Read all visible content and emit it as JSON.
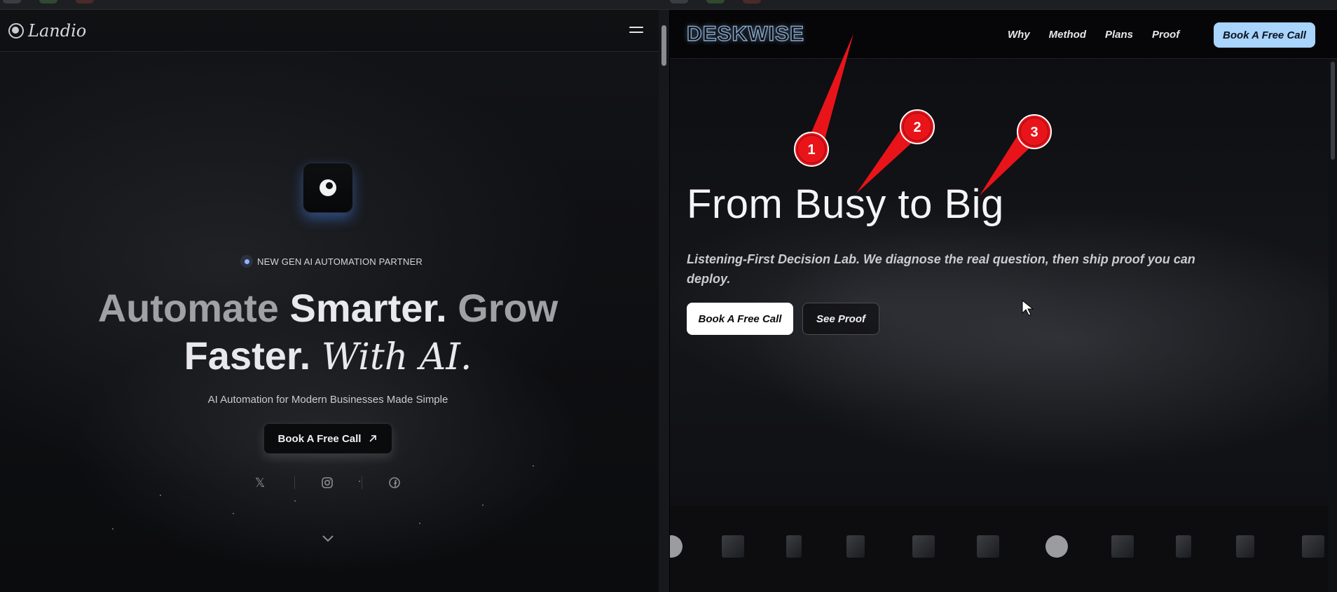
{
  "left_page": {
    "brand": "Landio",
    "badge": "NEW GEN AI AUTOMATION PARTNER",
    "headline": {
      "part1": "Automate ",
      "part2": "Smarter. ",
      "part3": "Grow",
      "part4": "Faster. ",
      "part5": "With AI."
    },
    "subline": "AI Automation for Modern Businesses Made Simple",
    "cta": "Book A Free Call",
    "socials": [
      "x-icon",
      "instagram-icon",
      "facebook-icon"
    ]
  },
  "right_page": {
    "logo": "DESKWISE",
    "nav": [
      "Why",
      "Method",
      "Plans",
      "Proof"
    ],
    "nav_cta": "Book A Free Call",
    "title": "From Busy to Big",
    "subtitle": "Listening-First Decision Lab. We diagnose the real question, then ship proof you can deploy.",
    "primary_button": "Book A Free Call",
    "secondary_button": "See Proof",
    "accent_color": "#a9d4fb"
  },
  "annotations": [
    {
      "label": "1",
      "color": "#e8141a"
    },
    {
      "label": "2",
      "color": "#e8141a"
    },
    {
      "label": "3",
      "color": "#e8141a"
    }
  ]
}
